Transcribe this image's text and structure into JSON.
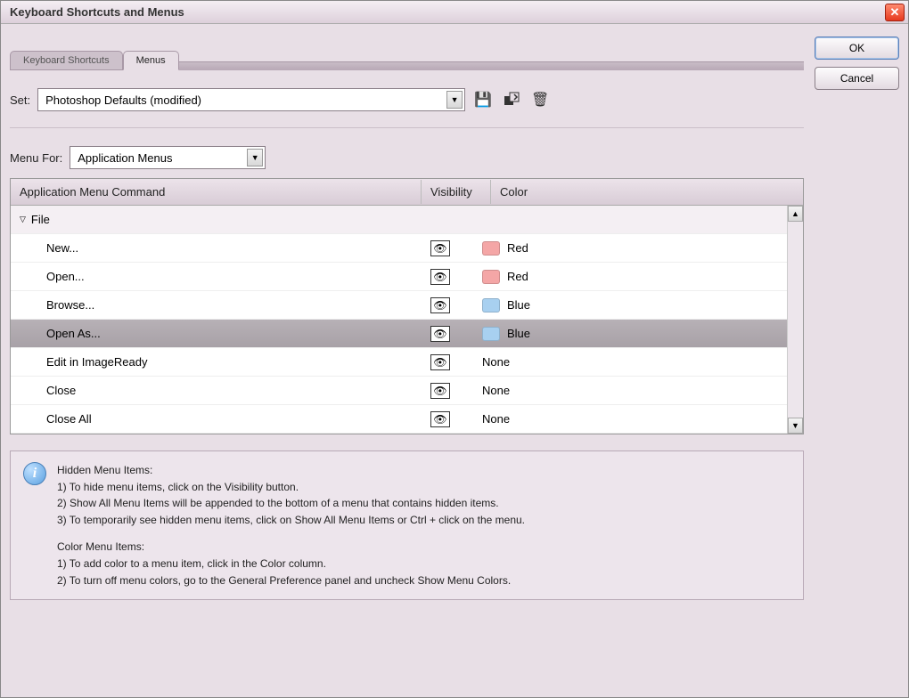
{
  "window": {
    "title": "Keyboard Shortcuts and Menus"
  },
  "buttons": {
    "ok": "OK",
    "cancel": "Cancel"
  },
  "tabs": {
    "shortcuts": "Keyboard Shortcuts",
    "menus": "Menus"
  },
  "set": {
    "label": "Set:",
    "value": "Photoshop Defaults (modified)"
  },
  "menuFor": {
    "label": "Menu For:",
    "value": "Application Menus"
  },
  "columns": {
    "command": "Application Menu Command",
    "visibility": "Visibility",
    "color": "Color"
  },
  "group": "File",
  "rows": [
    {
      "name": "New...",
      "color": "Red",
      "swatch": "red"
    },
    {
      "name": "Open...",
      "color": "Red",
      "swatch": "red"
    },
    {
      "name": "Browse...",
      "color": "Blue",
      "swatch": "blue"
    },
    {
      "name": "Open As...",
      "color": "Blue",
      "swatch": "blue",
      "selected": true
    },
    {
      "name": "Edit in ImageReady",
      "color": "None",
      "swatch": ""
    },
    {
      "name": "Close",
      "color": "None",
      "swatch": ""
    },
    {
      "name": "Close All",
      "color": "None",
      "swatch": ""
    }
  ],
  "info": {
    "hiddenTitle": "Hidden Menu Items:",
    "hidden1": "1) To hide menu items, click on the Visibility button.",
    "hidden2": "2) Show All Menu Items will be appended to the bottom of a menu that contains hidden items.",
    "hidden3": "3) To temporarily see hidden menu items, click on Show All Menu Items or Ctrl + click on the menu.",
    "colorTitle": "Color Menu Items:",
    "color1": "1) To add color to a menu item, click in the Color column.",
    "color2": "2) To turn off menu colors, go to the General Preference panel and uncheck Show Menu Colors."
  }
}
